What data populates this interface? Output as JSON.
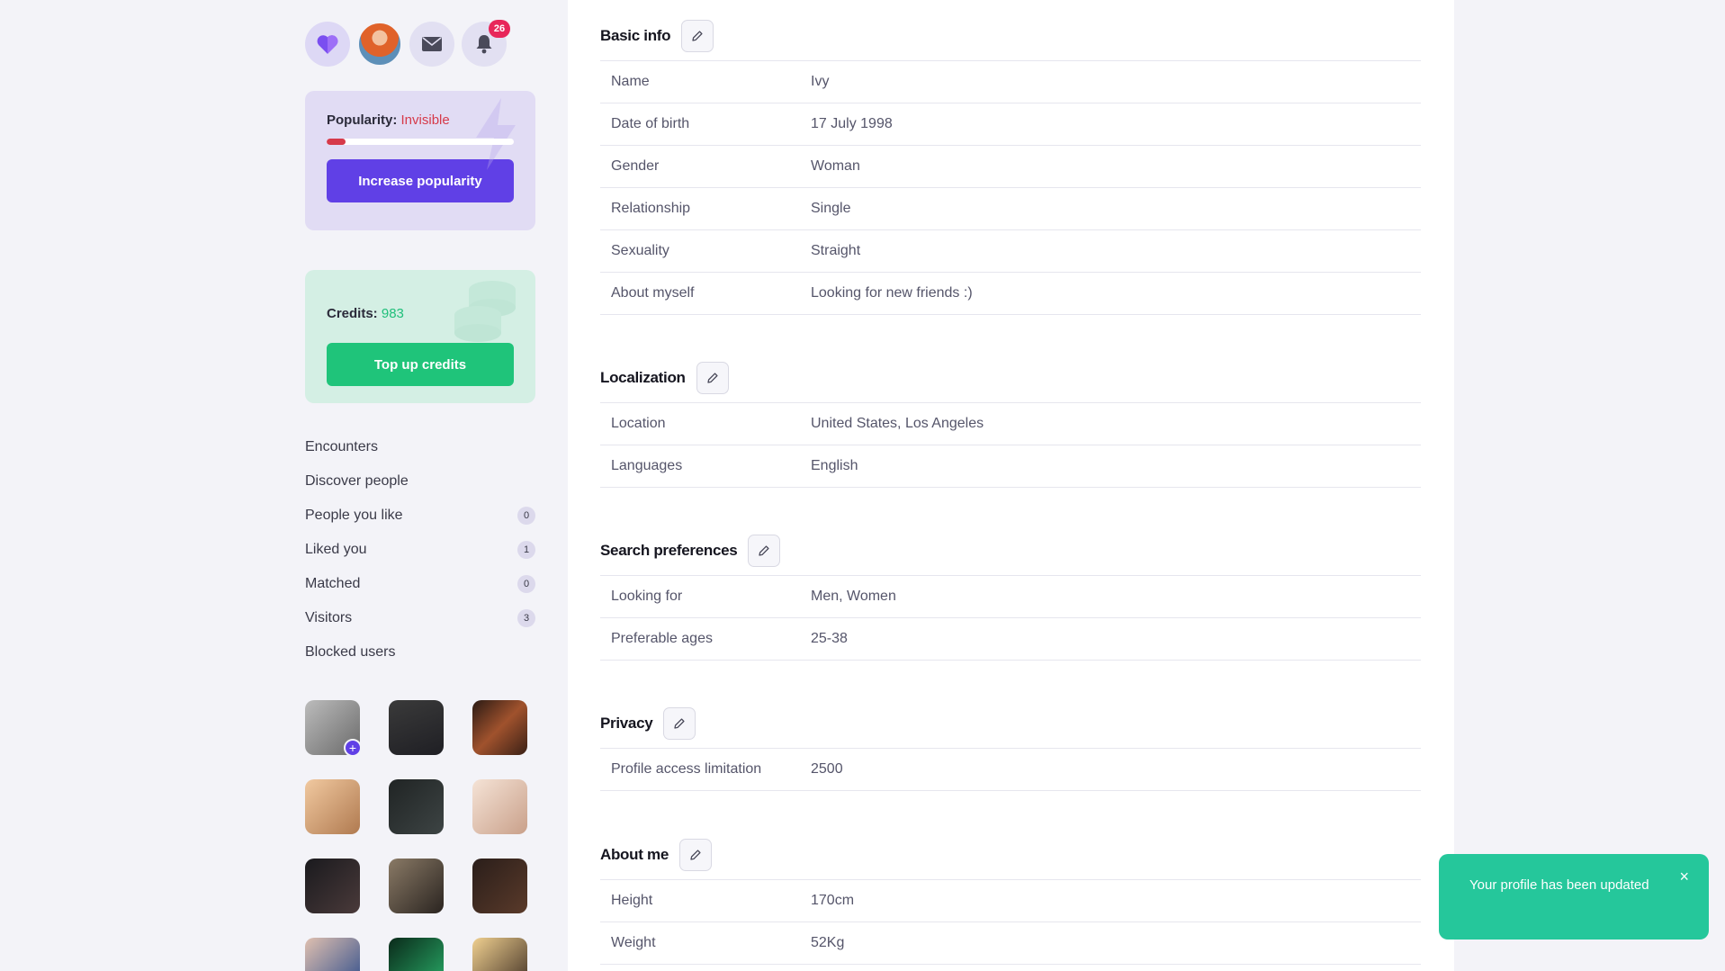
{
  "header": {
    "notifications_count": "26"
  },
  "popularity": {
    "label": "Popularity:",
    "value": "Invisible",
    "level_fraction": 0.1,
    "button": "Increase popularity"
  },
  "credits": {
    "label": "Credits:",
    "value": "983",
    "button": "Top up credits"
  },
  "menu": [
    {
      "label": "Encounters",
      "count": null
    },
    {
      "label": "Discover people",
      "count": null
    },
    {
      "label": "People you like",
      "count": "0"
    },
    {
      "label": "Liked you",
      "count": "1"
    },
    {
      "label": "Matched",
      "count": "0"
    },
    {
      "label": "Visitors",
      "count": "3"
    },
    {
      "label": "Blocked users",
      "count": null
    }
  ],
  "thumb_add": "+",
  "sections": {
    "basic": {
      "title": "Basic info",
      "rows": [
        {
          "k": "Name",
          "v": "Ivy"
        },
        {
          "k": "Date of birth",
          "v": "17 July 1998"
        },
        {
          "k": "Gender",
          "v": "Woman"
        },
        {
          "k": "Relationship",
          "v": "Single"
        },
        {
          "k": "Sexuality",
          "v": "Straight"
        },
        {
          "k": "About myself",
          "v": "Looking for new friends :)"
        }
      ]
    },
    "localization": {
      "title": "Localization",
      "rows": [
        {
          "k": "Location",
          "v": "United States, Los Angeles"
        },
        {
          "k": "Languages",
          "v": "English"
        }
      ]
    },
    "search": {
      "title": "Search preferences",
      "rows": [
        {
          "k": "Looking for",
          "v": "Men, Women"
        },
        {
          "k": "Preferable ages",
          "v": "25-38"
        }
      ]
    },
    "privacy": {
      "title": "Privacy",
      "rows": [
        {
          "k": "Profile access limitation",
          "v": "2500"
        }
      ]
    },
    "about": {
      "title": "About me",
      "rows": [
        {
          "k": "Height",
          "v": "170cm"
        },
        {
          "k": "Weight",
          "v": "52Kg"
        }
      ]
    }
  },
  "toast": {
    "message": "Your profile has been updated",
    "close": "×"
  },
  "colors": {
    "accent": "#6040e6",
    "green": "#1fc47a",
    "red": "#d63a4a",
    "toast": "#25c79b"
  }
}
